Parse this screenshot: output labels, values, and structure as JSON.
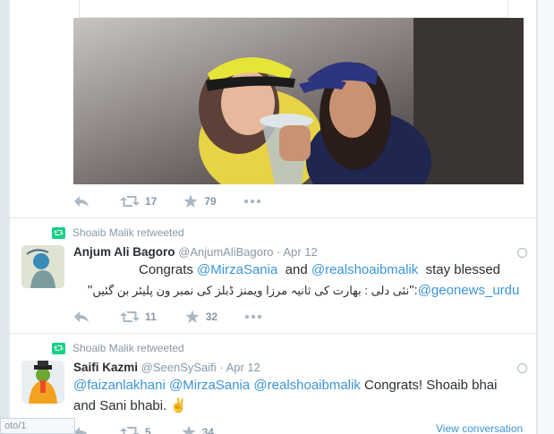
{
  "tweet1": {
    "stats": {
      "retweets": "17",
      "likes": "79"
    }
  },
  "tweet2": {
    "retweeted_by": "Shoaib Malik retweeted",
    "name": "Anjum Ali Bagoro",
    "handle": "@AnjumAliBagoro",
    "sep": "·",
    "time": "Apr 12",
    "line1": {
      "pre": "Congrats ",
      "m1": "@MirzaSania",
      "mid": "  and ",
      "m2": "@realshoaibmalik",
      "post": "  stay blessed"
    },
    "line2": {
      "urdu": "نئی دلی : بھارت کی ثانیہ مرزا ویمنز ڈبلز کی نمبر ون پلیئر بن گئیں",
      "quote": "\"",
      "tail": "\":",
      "mention": "@geonews_urdu"
    },
    "stats": {
      "retweets": "11",
      "likes": "32"
    }
  },
  "tweet3": {
    "retweeted_by": "Shoaib Malik retweeted",
    "name": "Saifi Kazmi",
    "handle": "@SeenSySaifi",
    "sep": "·",
    "time": "Apr 12",
    "line1": {
      "m1": "@faizanlakhani",
      "m2": "@MirzaSania",
      "m3": "@realshoaibmalik",
      "post": " Congrats! Shoaib bhai"
    },
    "line2": {
      "text": "and Sani bhabi. ",
      "emoji": "✌"
    },
    "view_conversation": "View conversation",
    "stats": {
      "retweets": "5",
      "likes": "34"
    }
  },
  "status_bar": {
    "label": "oto/1"
  },
  "colors": {
    "accent": "#3b94d9",
    "muted": "#8899a6",
    "retweet_green": "#19cf86",
    "like": "#8899a6"
  },
  "icons": [
    "reply-icon",
    "retweet-icon",
    "like-icon",
    "more-icon",
    "globe-icon",
    "retweet-badge-icon"
  ]
}
